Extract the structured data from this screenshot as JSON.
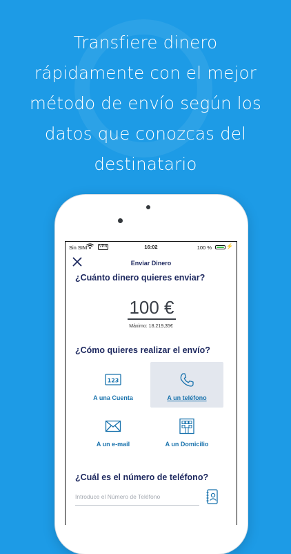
{
  "promo": {
    "headline": "Transfiere dinero\nrápidamente con el mejor\nmétodo de envío según los\ndatos que conozcas del\ndestinatario"
  },
  "status_bar": {
    "carrier": "Sin SIM",
    "vpn": "VPN",
    "time": "16:02",
    "battery_percent": "100 %"
  },
  "nav": {
    "title": "Enviar Dinero"
  },
  "amount_section": {
    "question": "¿Cuánto dinero quieres enviar?",
    "amount": "100 €",
    "maximum": "Máximo: 18.219,35€"
  },
  "method_section": {
    "question": "¿Cómo quieres realizar el envío?",
    "options": [
      {
        "label": "A una Cuenta",
        "icon": "account-number-icon",
        "selected": false
      },
      {
        "label": "A un teléfono",
        "icon": "phone-icon",
        "selected": true
      },
      {
        "label": "A un e-mail",
        "icon": "envelope-icon",
        "selected": false
      },
      {
        "label": "A un Domicilio",
        "icon": "building-icon",
        "selected": false
      }
    ]
  },
  "phone_section": {
    "question": "¿Cuál es el número de teléfono?",
    "placeholder": "Introduce el Número de Teléfono",
    "value": ""
  },
  "colors": {
    "background": "#1d9be6",
    "primary_text": "#1f2a60",
    "accent": "#1a73ad",
    "selected_bg": "#e3e7ee"
  }
}
